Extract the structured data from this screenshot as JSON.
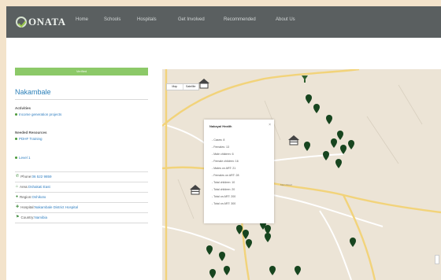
{
  "nav": {
    "logo": "ONATA",
    "logo_sub": "",
    "links": [
      "Home",
      "Schools",
      "Hospitals",
      "Get Involved",
      "Recommended",
      "About Us"
    ]
  },
  "sidebar": {
    "status_label": "Verified",
    "place_name": "Nakambale",
    "activities": {
      "heading": "Activities",
      "link": "Income generation projects"
    },
    "resources": {
      "heading": "Needed Resources",
      "link": "PDHF Training"
    },
    "level_link": "Level 1",
    "details": [
      {
        "label": "Phone: ",
        "value": "06 522 9859",
        "icon": "phone-icon"
      },
      {
        "label": "Area: ",
        "value": "Oshakati East",
        "icon": "home-icon"
      },
      {
        "label": "Region: ",
        "value": "Oshikoto",
        "icon": "marker-icon"
      },
      {
        "label": "Hospital: ",
        "value": "Nakambale District Hospital",
        "icon": "hospital-icon"
      },
      {
        "label": "Country: ",
        "value": "Namibia",
        "icon": "flag-icon"
      }
    ]
  },
  "map": {
    "controls": [
      "Map",
      "Satellite"
    ],
    "popup": {
      "title": "Nakayal Health",
      "items": [
        "Cases: 8",
        "Females: 13",
        "Male children: 6",
        "Female children: 16",
        "Males on ART: 21",
        "Females on ART: 28",
        "Total children: 10",
        "Total children: 20",
        "Total on ART: 200",
        "Total on ART: 300"
      ]
    },
    "road_label": "Main Road",
    "colors": {
      "pin": "#17451f",
      "road_major": "#f2d37a",
      "road_minor": "#ffffff",
      "land": "#ece4d6"
    }
  }
}
